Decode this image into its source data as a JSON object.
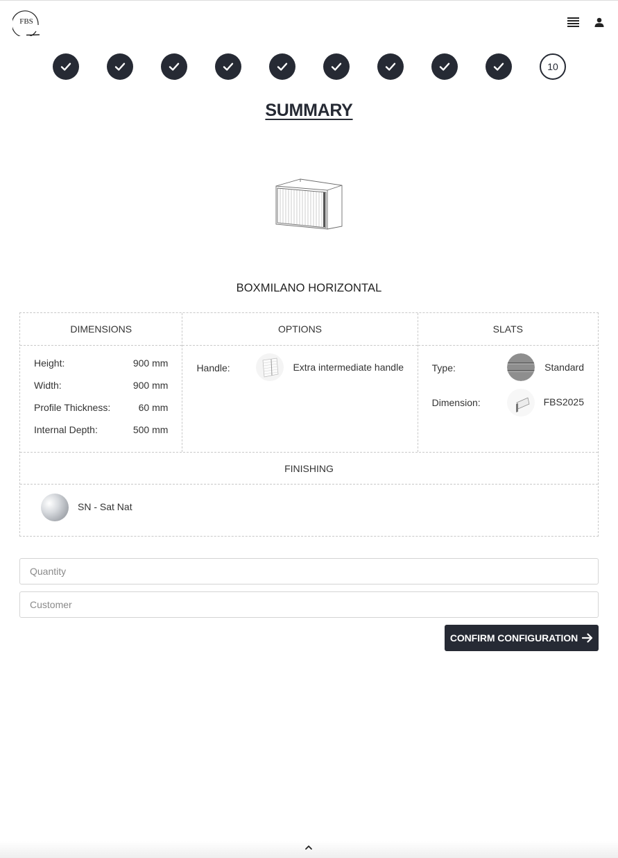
{
  "header": {
    "logo_text": "FBS",
    "menu_icon": "hamburger-menu-icon",
    "user_icon": "user-icon"
  },
  "steps": {
    "completed_count": 9,
    "current_label": "10",
    "check_icon": "checkmark-icon"
  },
  "page_title": "SUMMARY",
  "product": {
    "image_icon": "cabinet-box-icon",
    "name": "BOXMILANO HORIZONTAL"
  },
  "dimensions": {
    "heading": "DIMENSIONS",
    "items": [
      {
        "label": "Height:",
        "value": "900 mm"
      },
      {
        "label": "Width:",
        "value": "900 mm"
      },
      {
        "label": "Profile Thickness:",
        "value": "60 mm"
      },
      {
        "label": "Internal Depth:",
        "value": "500 mm"
      }
    ]
  },
  "options": {
    "heading": "OPTIONS",
    "handle_label": "Handle:",
    "handle_value": "Extra intermediate handle"
  },
  "slats": {
    "heading": "SLATS",
    "type_label": "Type:",
    "type_value": "Standard",
    "dimension_label": "Dimension:",
    "dimension_value": "FBS2025"
  },
  "finishing": {
    "heading": "FINISHING",
    "value": "SN - Sat Nat"
  },
  "form": {
    "quantity_placeholder": "Quantity",
    "quantity_value": "",
    "customer_placeholder": "Customer",
    "customer_value": ""
  },
  "confirm_label": "CONFIRM CONFIGURATION",
  "colors": {
    "primary": "#262a34",
    "border": "#c8c8c8"
  }
}
